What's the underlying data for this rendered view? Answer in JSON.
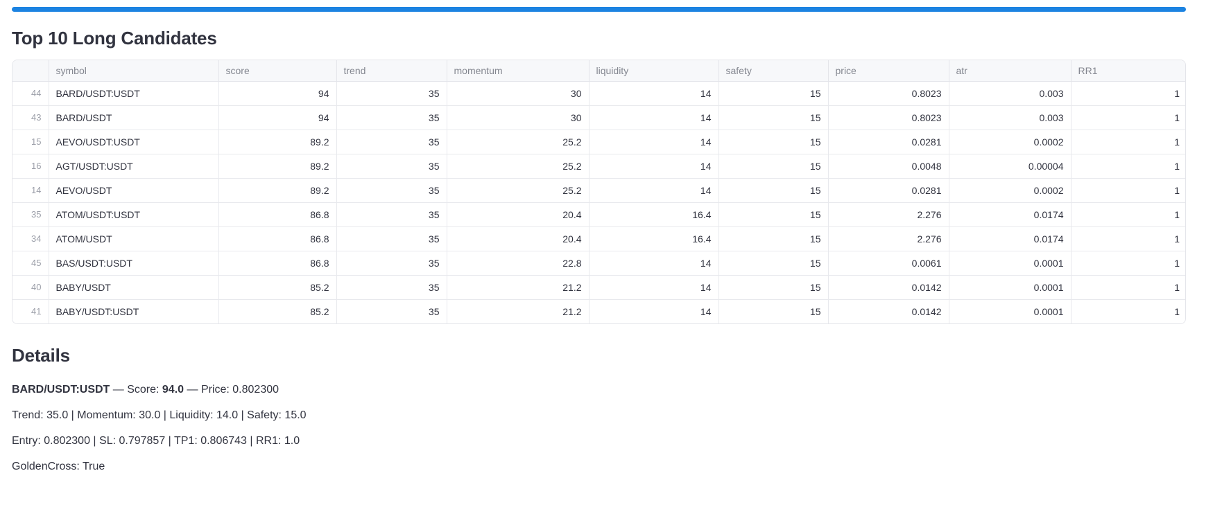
{
  "accent_color": "#1c83e1",
  "candidates": {
    "title": "Top 10 Long Candidates"
  },
  "table": {
    "columns": [
      "",
      "symbol",
      "score",
      "trend",
      "momentum",
      "liquidity",
      "safety",
      "price",
      "atr",
      "RR1"
    ],
    "rows": [
      {
        "index": "44",
        "symbol": "BARD/USDT:USDT",
        "score": "94",
        "trend": "35",
        "momentum": "30",
        "liquidity": "14",
        "safety": "15",
        "price": "0.8023",
        "atr": "0.003",
        "rr1": "1"
      },
      {
        "index": "43",
        "symbol": "BARD/USDT",
        "score": "94",
        "trend": "35",
        "momentum": "30",
        "liquidity": "14",
        "safety": "15",
        "price": "0.8023",
        "atr": "0.003",
        "rr1": "1"
      },
      {
        "index": "15",
        "symbol": "AEVO/USDT:USDT",
        "score": "89.2",
        "trend": "35",
        "momentum": "25.2",
        "liquidity": "14",
        "safety": "15",
        "price": "0.0281",
        "atr": "0.0002",
        "rr1": "1"
      },
      {
        "index": "16",
        "symbol": "AGT/USDT:USDT",
        "score": "89.2",
        "trend": "35",
        "momentum": "25.2",
        "liquidity": "14",
        "safety": "15",
        "price": "0.0048",
        "atr": "0.00004",
        "rr1": "1"
      },
      {
        "index": "14",
        "symbol": "AEVO/USDT",
        "score": "89.2",
        "trend": "35",
        "momentum": "25.2",
        "liquidity": "14",
        "safety": "15",
        "price": "0.0281",
        "atr": "0.0002",
        "rr1": "1"
      },
      {
        "index": "35",
        "symbol": "ATOM/USDT:USDT",
        "score": "86.8",
        "trend": "35",
        "momentum": "20.4",
        "liquidity": "16.4",
        "safety": "15",
        "price": "2.276",
        "atr": "0.0174",
        "rr1": "1"
      },
      {
        "index": "34",
        "symbol": "ATOM/USDT",
        "score": "86.8",
        "trend": "35",
        "momentum": "20.4",
        "liquidity": "16.4",
        "safety": "15",
        "price": "2.276",
        "atr": "0.0174",
        "rr1": "1"
      },
      {
        "index": "45",
        "symbol": "BAS/USDT:USDT",
        "score": "86.8",
        "trend": "35",
        "momentum": "22.8",
        "liquidity": "14",
        "safety": "15",
        "price": "0.0061",
        "atr": "0.0001",
        "rr1": "1"
      },
      {
        "index": "40",
        "symbol": "BABY/USDT",
        "score": "85.2",
        "trend": "35",
        "momentum": "21.2",
        "liquidity": "14",
        "safety": "15",
        "price": "0.0142",
        "atr": "0.0001",
        "rr1": "1"
      },
      {
        "index": "41",
        "symbol": "BABY/USDT:USDT",
        "score": "85.2",
        "trend": "35",
        "momentum": "21.2",
        "liquidity": "14",
        "safety": "15",
        "price": "0.0142",
        "atr": "0.0001",
        "rr1": "1"
      }
    ]
  },
  "details": {
    "title": "Details",
    "line1": {
      "symbol": "BARD/USDT:USDT",
      "mid1": " — Score: ",
      "score": "94.0",
      "mid2": " — Price: 0.802300"
    },
    "line2": "Trend: 35.0 | Momentum: 30.0 | Liquidity: 14.0 | Safety: 15.0",
    "line3": "Entry: 0.802300 | SL: 0.797857 | TP1: 0.806743 | RR1: 1.0",
    "line4": "GoldenCross: True"
  }
}
